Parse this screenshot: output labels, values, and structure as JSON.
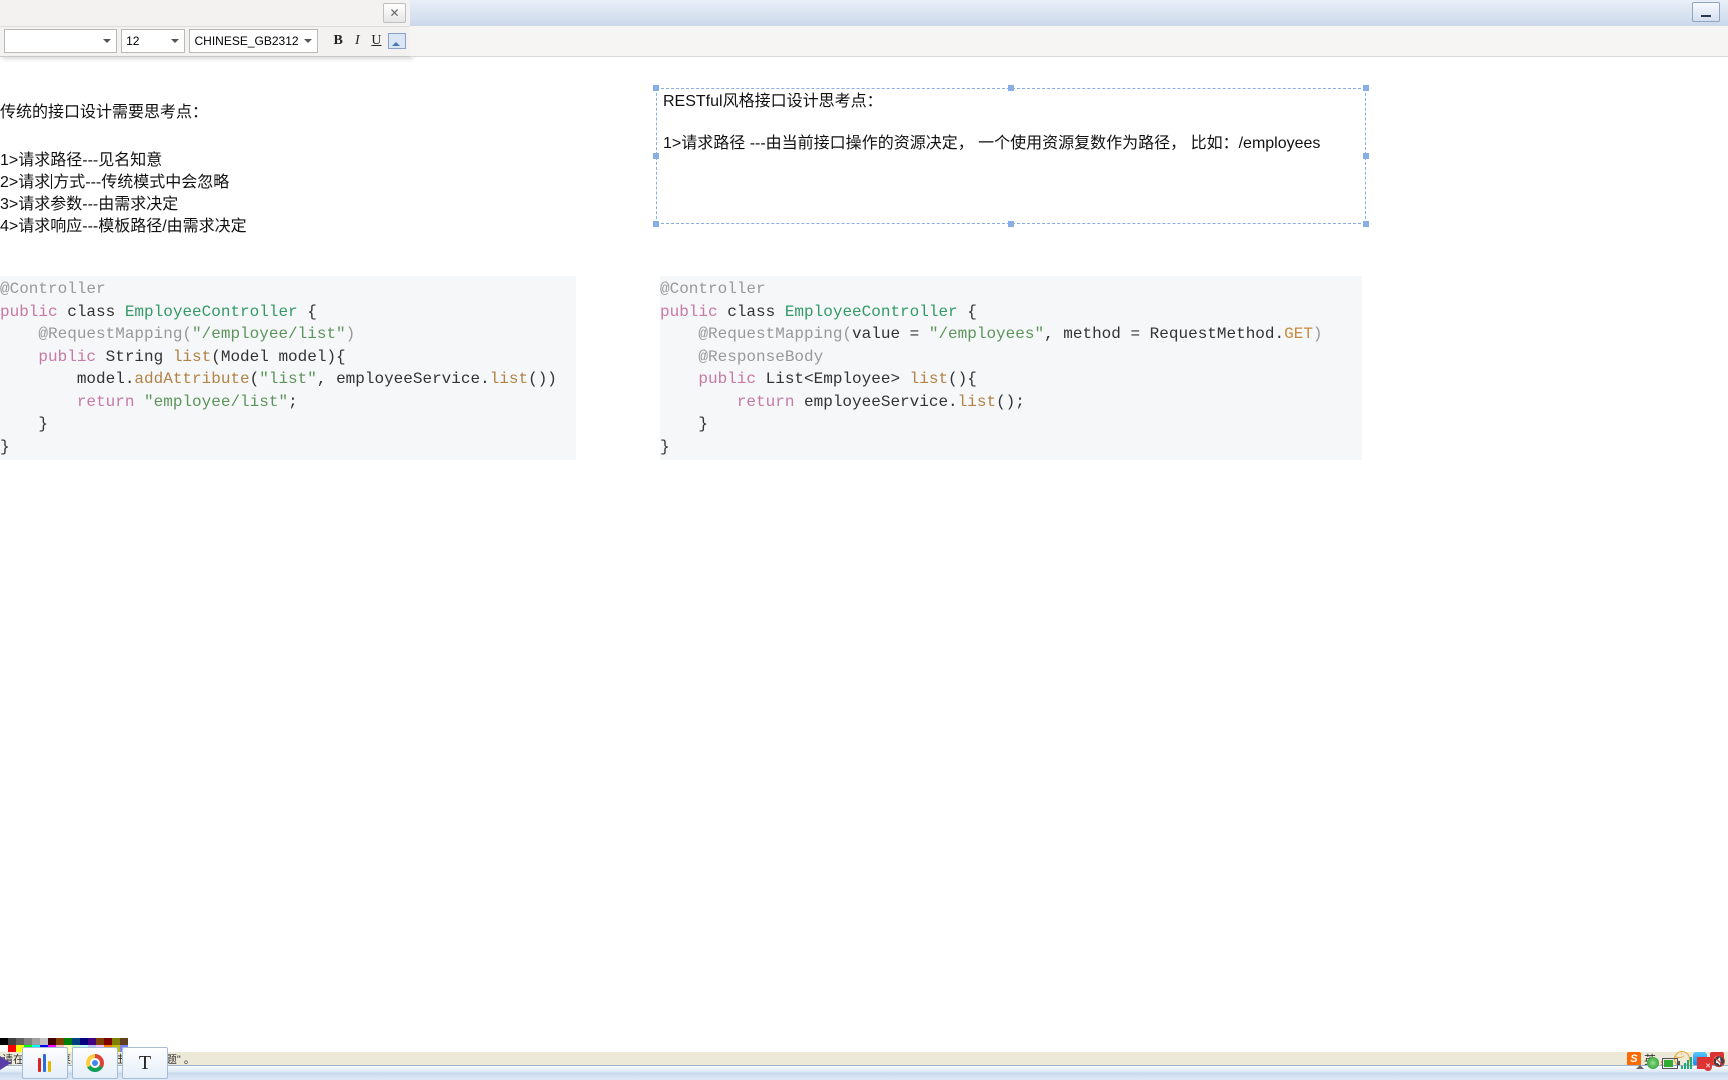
{
  "toolbar": {
    "font": "",
    "size": "12",
    "lang": "CHINESE_GB2312",
    "bold": "B",
    "italic": "I",
    "under": "U"
  },
  "left_note": {
    "title": "传统的接口设计需要思考点：",
    "l1": "1>请求路径---见名知意",
    "l2": "2>请求方式---传统模式中会忽略",
    "l3": "3>请求参数---由需求决定",
    "l4": "4>请求响应---模板路径/由需求决定"
  },
  "right_note": {
    "title": "RESTful风格接口设计思考点：",
    "l1a": "1>请求路径 ---由当前接口操",
    "l1b": "的资源决定，  一个使用资源复数作为路径，  比如：/employees"
  },
  "codeL": {
    "l1a": "@Controller",
    "l2a": "public",
    "l2b": " class ",
    "l2c": "EmployeeController",
    "l2d": " {",
    "l3a": "    ",
    "l3b": "@RequestMapping(",
    "l3c": "\"/employee/list\"",
    "l3d": ")",
    "l4a": "    ",
    "l4b": "public",
    "l4c": " String ",
    "l4d": "list",
    "l4e": "(Model model){",
    "l5a": "        model.",
    "l5b": "addAttribute",
    "l5c": "(",
    "l5d": "\"list\"",
    "l5e": ", employeeService.",
    "l5f": "list",
    "l5g": "())",
    "l6a": "        ",
    "l6b": "return",
    "l6c": " ",
    "l6d": "\"employee/list\"",
    "l6e": ";",
    "l7": "    }",
    "l8": "}"
  },
  "codeR": {
    "l1a": "@Controller",
    "l2a": "public",
    "l2b": " class ",
    "l2c": "EmployeeController",
    "l2d": " {",
    "l3a": "    ",
    "l3b": "@RequestMapping(",
    "l3c": "value = ",
    "l3d": "\"/employees\"",
    "l3e": ", method = RequestMethod.",
    "l3f": "GET",
    "l3g": ")",
    "l4a": "    ",
    "l4b": "@ResponseBody",
    "l5a": "    ",
    "l5b": "public",
    "l5c": " List<Employee> ",
    "l5d": "list",
    "l5e": "(){",
    "l6a": "        ",
    "l6b": "return",
    "l6c": " employeeService.",
    "l6d": "list",
    "l6e": "();",
    "l7": "    }",
    "l8": "}"
  },
  "status": {
    "text": "请在 \"帮助\" 菜单中，单击 \"帮助主题\" 。",
    "ime": "英",
    "imep": "，"
  },
  "palette": {
    "row1": [
      "#000",
      "#404040",
      "#606060",
      "#808080",
      "#a0a0a0",
      "#c0c0c0",
      "#400000",
      "#804000",
      "#008000",
      "#004080",
      "#000080",
      "#400080",
      "#804000",
      "#800000",
      "#808000",
      "#604020"
    ],
    "row2": [
      "#fff",
      "#ff0000",
      "#ffff00",
      "#00ff00",
      "#00ffff",
      "#0000ff",
      "#ff00ff",
      "#ffc0c0",
      "#ffffc0",
      "#c0ffc0",
      "#c0ffff",
      "#c0c0ff",
      "#ffc0ff",
      "#ff8000",
      "#c0c000",
      "#8080ff"
    ]
  }
}
